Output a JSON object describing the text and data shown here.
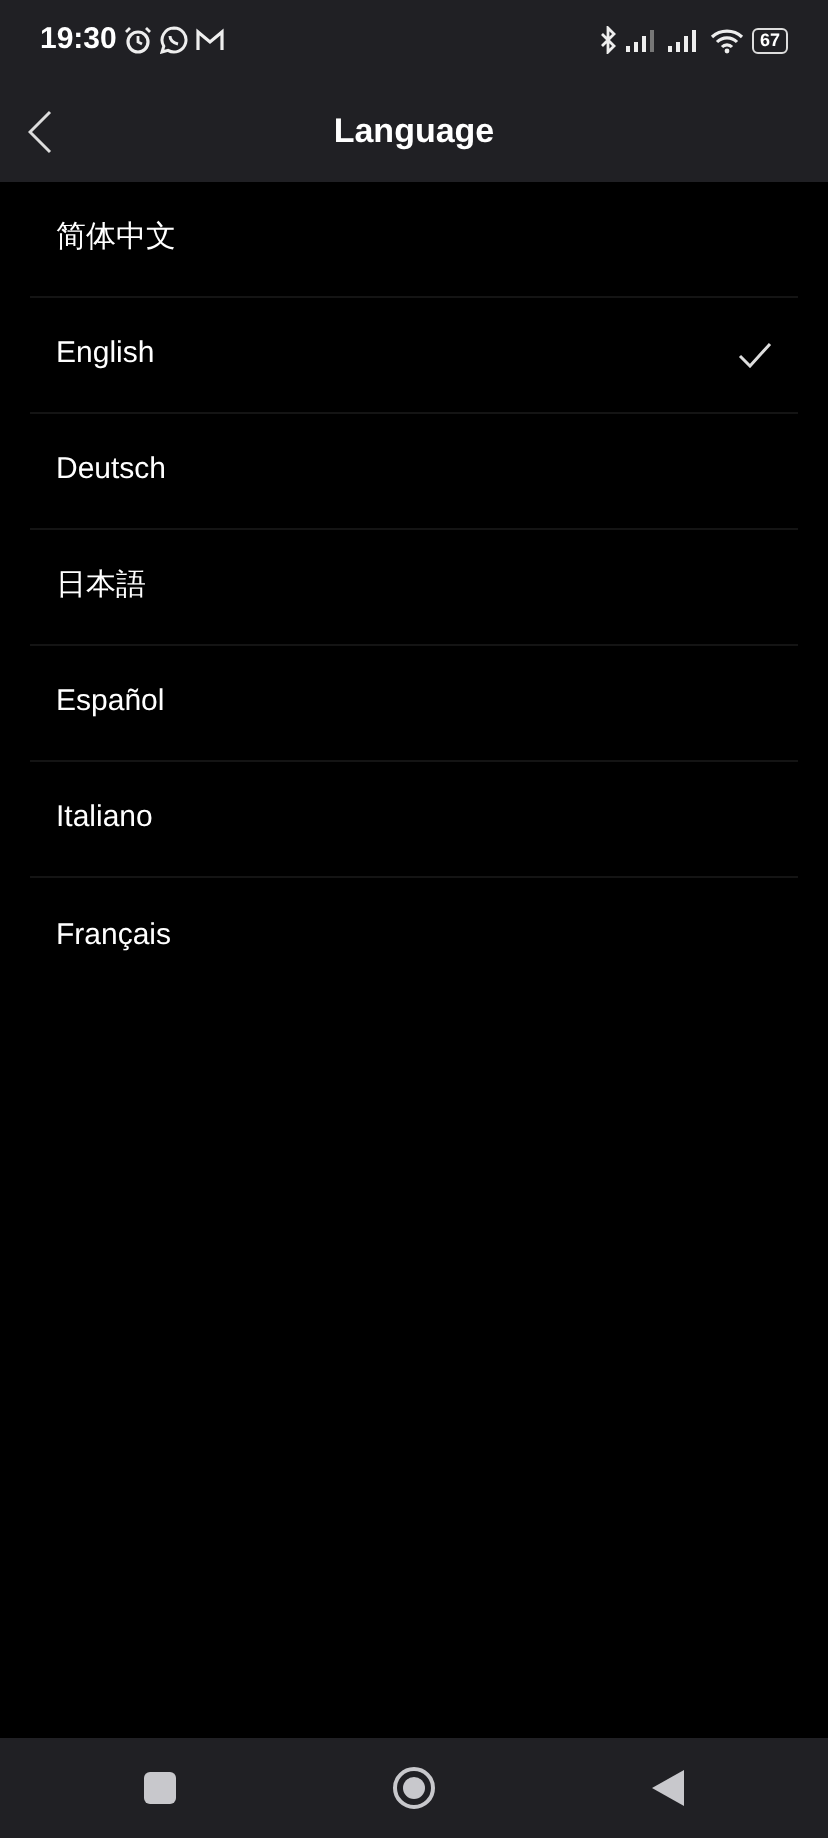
{
  "status_bar": {
    "time": "19:30",
    "battery": "67"
  },
  "header": {
    "title": "Language"
  },
  "languages": [
    {
      "label": "简体中文",
      "selected": false
    },
    {
      "label": "English",
      "selected": true
    },
    {
      "label": "Deutsch",
      "selected": false
    },
    {
      "label": "日本語",
      "selected": false
    },
    {
      "label": "Español",
      "selected": false
    },
    {
      "label": "Italiano",
      "selected": false
    },
    {
      "label": "Français",
      "selected": false
    }
  ]
}
